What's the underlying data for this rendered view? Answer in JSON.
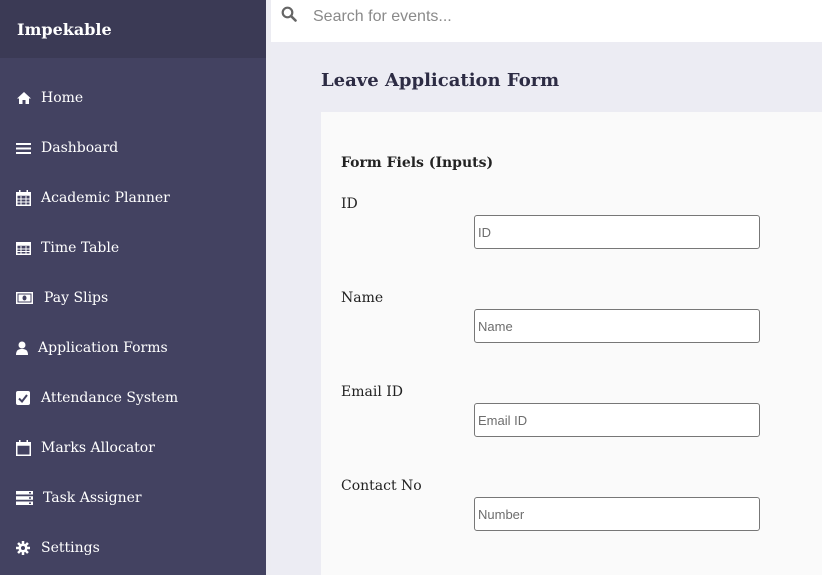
{
  "app": {
    "brand": "Impekable"
  },
  "search": {
    "placeholder": "Search for events..."
  },
  "sidebar": {
    "items": [
      {
        "label": "Home",
        "icon": "home-icon"
      },
      {
        "label": "Dashboard",
        "icon": "menu-icon"
      },
      {
        "label": "Academic Planner",
        "icon": "calendar-grid-icon"
      },
      {
        "label": "Time Table",
        "icon": "table-icon"
      },
      {
        "label": "Pay Slips",
        "icon": "money-icon"
      },
      {
        "label": "Application Forms",
        "icon": "user-icon"
      },
      {
        "label": "Attendance System",
        "icon": "checkbox-icon"
      },
      {
        "label": "Marks Allocator",
        "icon": "calendar-icon"
      },
      {
        "label": "Task Assigner",
        "icon": "list-icon"
      },
      {
        "label": "Settings",
        "icon": "gear-icon"
      }
    ]
  },
  "page": {
    "title": "Leave Application Form"
  },
  "form": {
    "section_title": "Form Fiels (Inputs)",
    "fields": [
      {
        "label": "ID",
        "placeholder": "ID"
      },
      {
        "label": "Name",
        "placeholder": "Name"
      },
      {
        "label": "Email ID",
        "placeholder": "Email ID"
      },
      {
        "label": "Contact No",
        "placeholder": "Number"
      }
    ]
  },
  "colors": {
    "sidebar_bg": "#434261",
    "brand_bg": "#3b3a55",
    "header_bg": "#ececf3",
    "card_bg": "#fafafa",
    "title_color": "#2d2c44"
  }
}
